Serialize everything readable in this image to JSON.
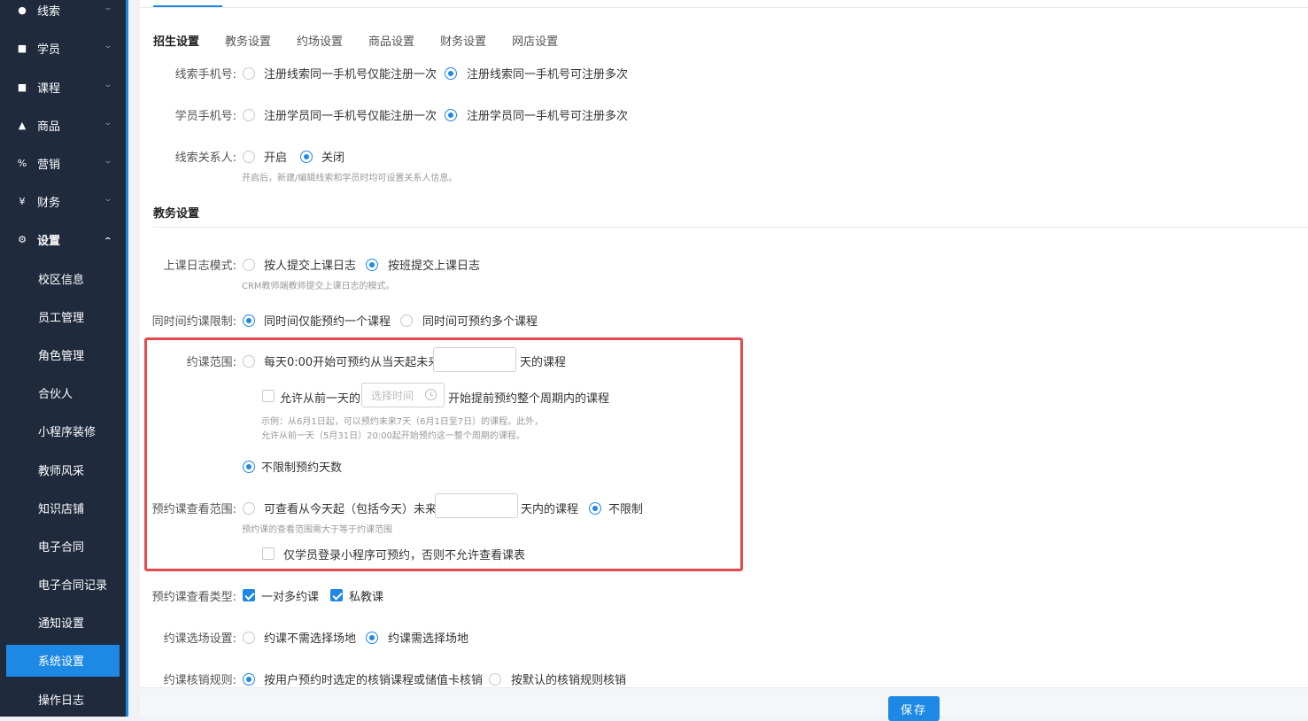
{
  "sidebar": {
    "menu": [
      {
        "label": "线索",
        "icon": "user-icon"
      },
      {
        "label": "学员",
        "icon": "student-icon"
      },
      {
        "label": "课程",
        "icon": "book-icon"
      },
      {
        "label": "商品",
        "icon": "bag-icon"
      },
      {
        "label": "营销",
        "icon": "percent-icon"
      },
      {
        "label": "财务",
        "icon": "money-icon"
      },
      {
        "label": "设置",
        "icon": "gear-icon"
      }
    ],
    "sub": [
      "校区信息",
      "员工管理",
      "角色管理",
      "合伙人",
      "小程序装修",
      "教师风采",
      "知识店铺",
      "电子合同",
      "电子合同记录",
      "通知设置",
      "系统设置",
      "操作日志"
    ],
    "active_sub": "系统设置"
  },
  "tabs": [
    "招生设置",
    "教务设置",
    "约场设置",
    "商品设置",
    "财务设置",
    "网店设置"
  ],
  "enroll": {
    "clue_phone_label": "线索手机号:",
    "clue_phone_opt1": "注册线索同一手机号仅能注册一次",
    "clue_phone_opt2": "注册线索同一手机号可注册多次",
    "student_phone_label": "学员手机号:",
    "student_phone_opt1": "注册学员同一手机号仅能注册一次",
    "student_phone_opt2": "注册学员同一手机号可注册多次",
    "contact_label": "线索关系人:",
    "contact_opt1": "开启",
    "contact_opt2": "关闭",
    "contact_hint": "开启后，新建/编辑线索和学员时均可设置关系人信息。"
  },
  "academic": {
    "title": "教务设置",
    "log_label": "上课日志模式:",
    "log_opt1": "按人提交上课日志",
    "log_opt2": "按班提交上课日志",
    "log_hint": "CRM教师端教师提交上课日志的模式。",
    "limit_label": "同时间约课限制:",
    "limit_opt1": "同时间仅能预约一个课程",
    "limit_opt2": "同时间可预约多个课程",
    "range_label": "约课范围:",
    "range_opt1_pre": "每天0:00开始可预约从当天起未来",
    "range_opt1_post": "天的课程",
    "allow_pre": "允许从前一天的",
    "time_placeholder": "选择时间",
    "allow_post": "开始提前预约整个周期内的课程",
    "example1": "示例：从6月1日起，可以预约未来7天（6月1日至7日）的课程。此外，",
    "example2": "允许从前一天（5月31日）20:00起开始预约这一整个周期的课程。",
    "range_opt2": "不限制预约天数",
    "view_label": "预约课查看范围:",
    "view_opt1_pre": "可查看从今天起（包括今天）未来",
    "view_opt1_post": "天内的课程",
    "view_opt2": "不限制",
    "view_hint": "预约课的查看范围需大于等于约课范围",
    "student_only": "仅学员登录小程序可预约，否则不允许查看课表",
    "type_label": "预约课查看类型:",
    "type_opt1": "一对多约课",
    "type_opt2": "私教课",
    "venue_label": "约课选场设置:",
    "venue_opt1": "约课不需选择场地",
    "venue_opt2": "约课需选择场地",
    "verify_label": "约课核销规则:",
    "verify_opt1": "按用户预约时选定的核销课程或储值卡核销",
    "verify_opt2": "按默认的核销规则核销"
  },
  "save_label": "保存"
}
